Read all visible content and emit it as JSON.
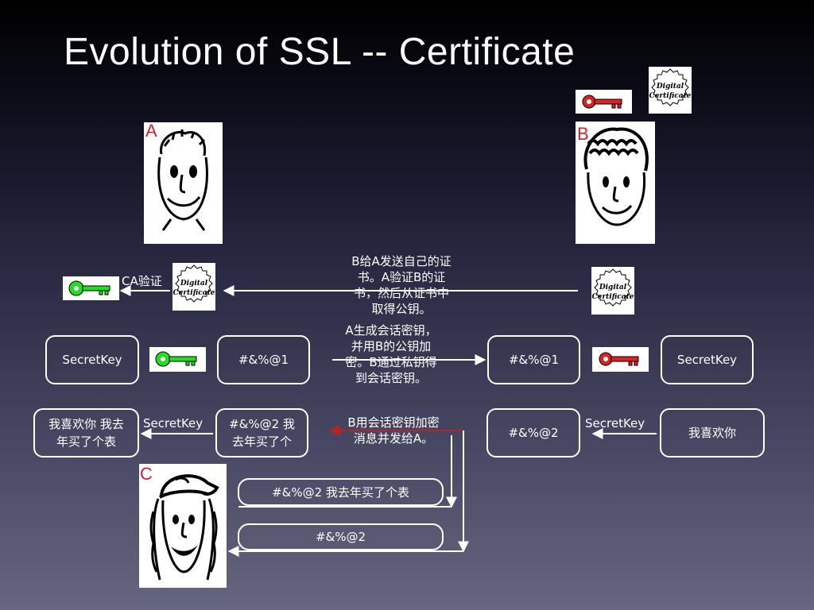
{
  "slide": {
    "title": "Evolution of SSL -- Certificate"
  },
  "actors": {
    "a": {
      "label": "A"
    },
    "b": {
      "label": "B"
    },
    "c": {
      "label": "C"
    }
  },
  "certificate": {
    "line1": "Digital",
    "line2": "Certificate"
  },
  "keys": {
    "public_key_color": "#22dd22",
    "private_key_color": "#dd2222"
  },
  "labels": {
    "ca_verify": "CA验证",
    "secretkey_left": "SecretKey",
    "secretkey_right": "SecretKey"
  },
  "notes": {
    "send_cert": [
      "B给A发送自己的证",
      "书。A验证B的证",
      "书，然后从证书中",
      "取得公钥。"
    ],
    "session_key": [
      "A生成会话密钥，",
      "并用B的公钥加",
      "密。B通过私钥得",
      "到会话密钥。"
    ],
    "encrypt_msg": [
      "B用会话密钥加密",
      "消息并发给A。"
    ]
  },
  "boxes": {
    "a_secretkey": "SecretKey",
    "a_cipher1": "#&%@1",
    "b_cipher1": "#&%@1",
    "b_secretkey": "SecretKey",
    "a_plain": [
      "我喜欢你 我去",
      "年买了个表"
    ],
    "a_cipher2": [
      "#&%@2 我",
      "去年买了个"
    ],
    "b_cipher2": "#&%@2",
    "b_plain": "我喜欢你"
  },
  "pills": {
    "tampered": "#&%@2 我去年买了个表",
    "intercepted": "#&%@2"
  }
}
